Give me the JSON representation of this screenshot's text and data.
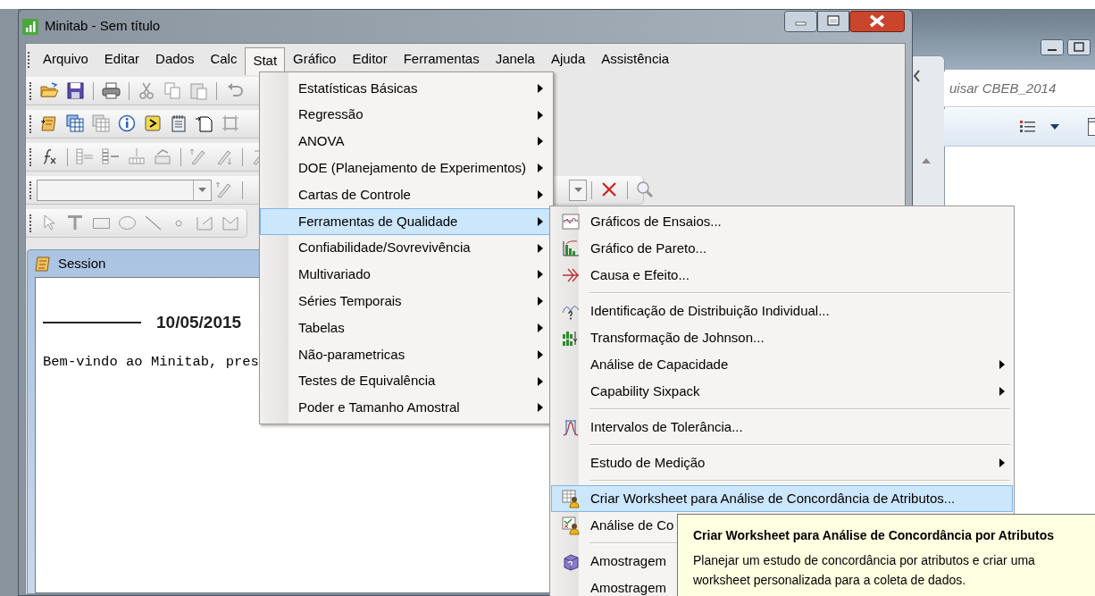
{
  "window": {
    "title": "Minitab - Sem título"
  },
  "menu_bar": [
    {
      "label": "Arquivo",
      "selected": false
    },
    {
      "label": "Editar",
      "selected": false
    },
    {
      "label": "Dados",
      "selected": false
    },
    {
      "label": "Calc",
      "selected": false
    },
    {
      "label": "Stat",
      "selected": true
    },
    {
      "label": "Gráfico",
      "selected": false
    },
    {
      "label": "Editor",
      "selected": false
    },
    {
      "label": "Ferramentas",
      "selected": false
    },
    {
      "label": "Janela",
      "selected": false
    },
    {
      "label": "Ajuda",
      "selected": false
    },
    {
      "label": "Assistência",
      "selected": false
    }
  ],
  "session": {
    "title": "Session",
    "date": "10/05/2015",
    "text": "Bem-vindo ao Minitab, pres"
  },
  "stat_menu": {
    "items": [
      {
        "label": "Estatísticas Básicas",
        "selected": false,
        "submenu": true
      },
      {
        "label": "Regressão",
        "selected": false,
        "submenu": true
      },
      {
        "label": "ANOVA",
        "selected": false,
        "submenu": true
      },
      {
        "label": "DOE (Planejamento de Experimentos)",
        "selected": false,
        "submenu": true
      },
      {
        "label": "Cartas de Controle",
        "selected": false,
        "submenu": true
      },
      {
        "label": "Ferramentas de Qualidade",
        "selected": true,
        "submenu": true
      },
      {
        "label": "Confiabilidade/Sovrevivência",
        "selected": false,
        "submenu": true
      },
      {
        "label": "Multivariado",
        "selected": false,
        "submenu": true
      },
      {
        "label": "Séries Temporais",
        "selected": false,
        "submenu": true
      },
      {
        "label": "Tabelas",
        "selected": false,
        "submenu": true
      },
      {
        "label": "Não-parametricas",
        "selected": false,
        "submenu": true
      },
      {
        "label": "Testes de Equivalência",
        "selected": false,
        "submenu": true
      },
      {
        "label": "Poder e Tamanho Amostral",
        "selected": false,
        "submenu": true
      }
    ]
  },
  "quality_submenu": {
    "items": [
      {
        "kind": "item",
        "label": "Gráficos de Ensaios...",
        "selected": false,
        "submenu": false
      },
      {
        "kind": "item",
        "label": "Gráfico de Pareto...",
        "selected": false,
        "submenu": false
      },
      {
        "kind": "item",
        "label": "Causa e Efeito...",
        "selected": false,
        "submenu": false
      },
      {
        "kind": "separator"
      },
      {
        "kind": "item",
        "label": "Identificação de Distribuição Individual...",
        "selected": false,
        "submenu": false
      },
      {
        "kind": "item",
        "label": "Transformação de Johnson...",
        "selected": false,
        "submenu": false
      },
      {
        "kind": "item",
        "label": "Análise de Capacidade",
        "selected": false,
        "submenu": true
      },
      {
        "kind": "item",
        "label": "Capability Sixpack",
        "selected": false,
        "submenu": true
      },
      {
        "kind": "separator"
      },
      {
        "kind": "item",
        "label": "Intervalos de Tolerância...",
        "selected": false,
        "submenu": false
      },
      {
        "kind": "separator"
      },
      {
        "kind": "item",
        "label": "Estudo de Medição",
        "selected": false,
        "submenu": true
      },
      {
        "kind": "separator"
      },
      {
        "kind": "item",
        "label": "Criar Worksheet para Análise de Concordância de Atributos...",
        "selected": true,
        "submenu": false
      },
      {
        "kind": "item",
        "label": "Análise de Co",
        "selected": false,
        "submenu": false
      },
      {
        "kind": "separator"
      },
      {
        "kind": "item",
        "label": "Amostragem",
        "selected": false,
        "submenu": false
      },
      {
        "kind": "item",
        "label": "Amostragem",
        "selected": false,
        "submenu": false
      }
    ]
  },
  "tooltip": {
    "title": "Criar Worksheet para Análise de Concordância por Atributos",
    "text": "Planejar um estudo de concordância por atributos e criar uma worksheet personalizada para a coleta de dados."
  },
  "background_window": {
    "search_text": "uisar CBEB_2014"
  }
}
